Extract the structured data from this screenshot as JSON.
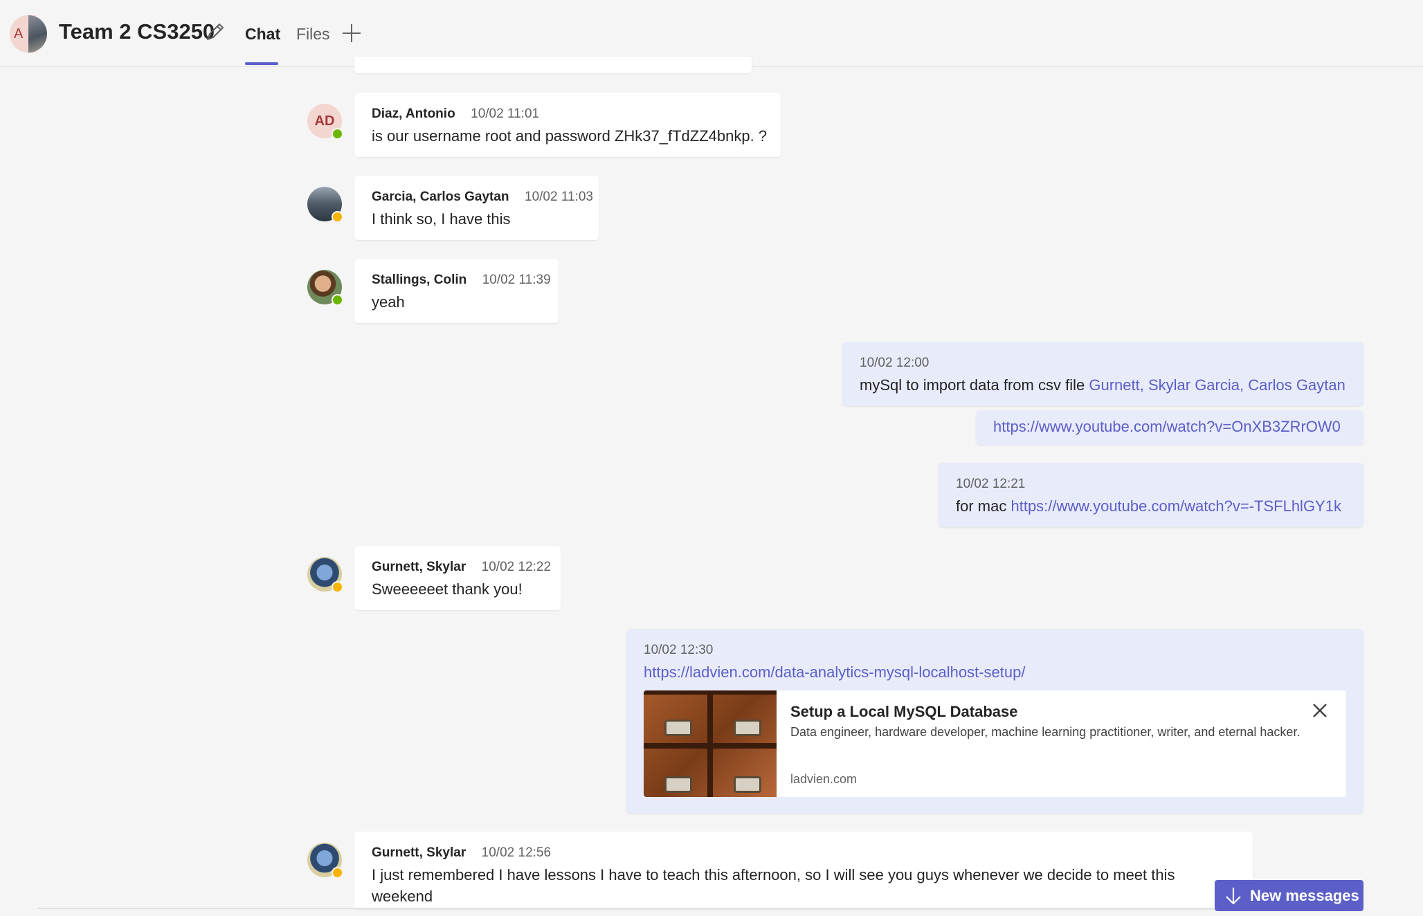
{
  "header": {
    "avatar_initial": "A",
    "title": "Team 2 CS3250",
    "tabs": [
      {
        "label": "Chat",
        "active": true
      },
      {
        "label": "Files",
        "active": false
      }
    ],
    "add_tab_icon": "plus-icon",
    "edit_icon": "pencil-icon"
  },
  "messages": [
    {
      "author": "Diaz, Antonio",
      "initials": "AD",
      "time": "10/02 11:01",
      "text": "is our username root and password ZHk37_fTdZZ4bnkp. ?",
      "status": "available"
    },
    {
      "author": "Garcia, Carlos Gaytan",
      "time": "10/02 11:03",
      "text": "I think so, I have this",
      "status": "away"
    },
    {
      "author": "Stallings, Colin",
      "time": "10/02 11:39",
      "text": "yeah",
      "status": "available"
    },
    {
      "mine": true,
      "time": "10/02 12:00",
      "text": "mySql to import data from csv file",
      "mentions": [
        "Gurnett, Skylar",
        "Garcia, Carlos Gaytan"
      ],
      "followup_link": "https://www.youtube.com/watch?v=OnXB3ZRrOW0"
    },
    {
      "mine": true,
      "time": "10/02 12:21",
      "text": "for mac",
      "link": "https://www.youtube.com/watch?v=-TSFLhlGY1k"
    },
    {
      "author": "Gurnett, Skylar",
      "time": "10/02 12:22",
      "text": "Sweeeeeet thank you!",
      "status": "away"
    },
    {
      "mine": true,
      "time": "10/02 12:30",
      "link": "https://ladvien.com/data-analytics-mysql-localhost-setup/",
      "preview": {
        "title": "Setup a Local MySQL Database",
        "description": "Data engineer, hardware developer, machine learning practitioner, writer, and eternal hacker.",
        "domain": "ladvien.com"
      }
    },
    {
      "author": "Gurnett, Skylar",
      "time": "10/02 12:56",
      "text_line1": "I just remembered I have lessons I have to teach this afternoon, so I will see you guys whenever we decide to meet this",
      "text_line2": "weekend",
      "status": "away"
    }
  ],
  "new_messages_button": "New messages",
  "colors": {
    "accent": "#5b5fc7",
    "available": "#6bb700",
    "away": "#f8b400",
    "my_bubble": "#e8ebfa"
  }
}
